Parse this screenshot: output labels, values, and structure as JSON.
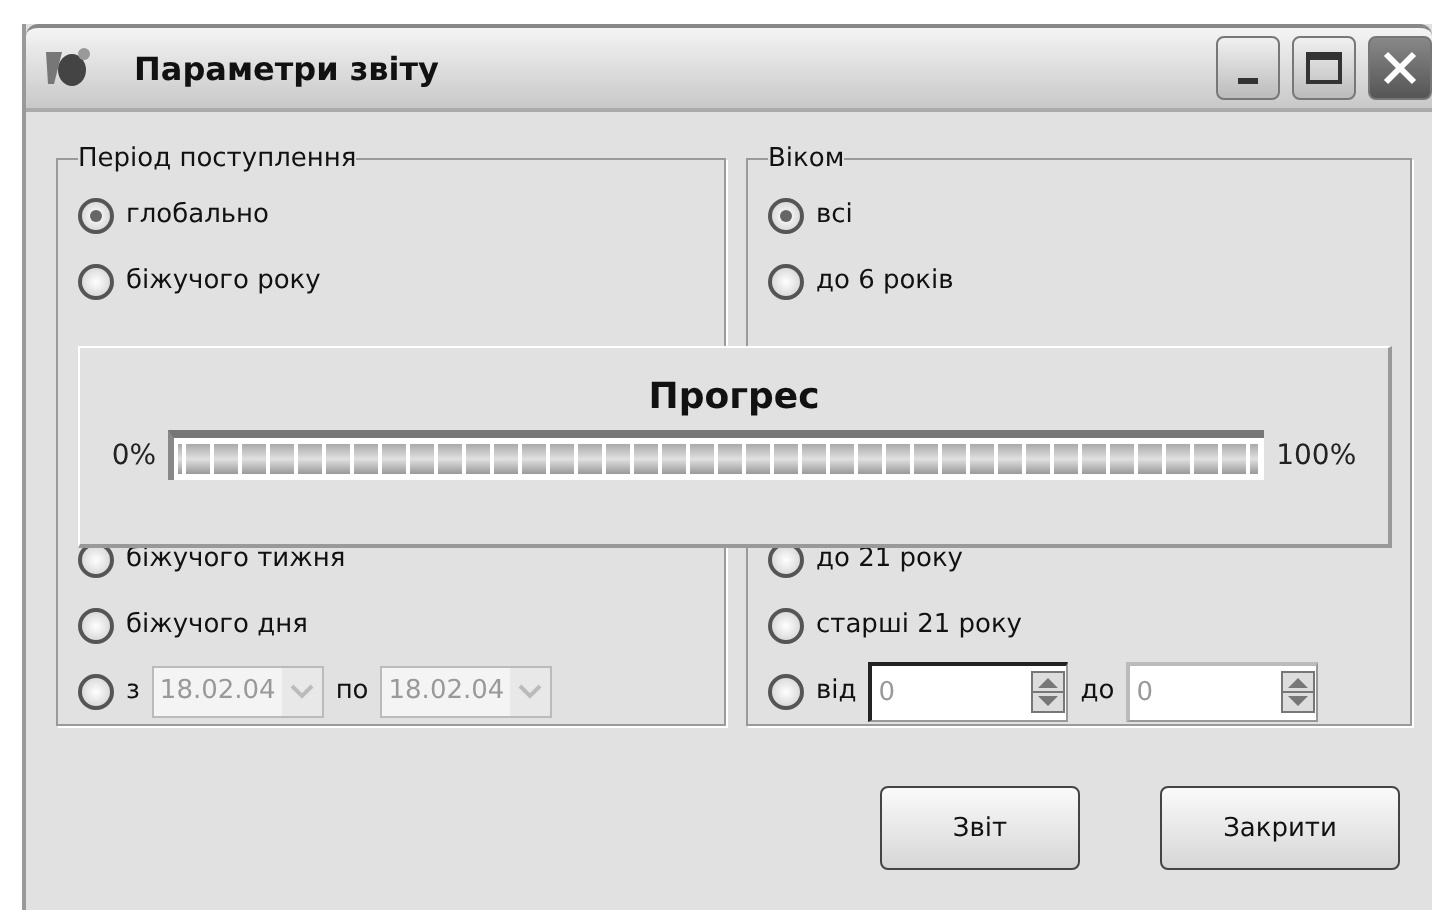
{
  "window": {
    "title": "Параметри звіту"
  },
  "groups": [
    {
      "legend": "Період поступлення",
      "options": [
        {
          "kind": "option",
          "label": "глобально",
          "selected": true
        },
        {
          "kind": "option",
          "label": "біжучого року",
          "selected": false
        },
        {
          "kind": "option",
          "label": "біжучого тижня",
          "selected": false
        },
        {
          "kind": "option",
          "label": "біжучого дня",
          "selected": false
        },
        {
          "kind": "date_range",
          "label": "з",
          "from": "18.02.04",
          "to_label": "по",
          "to": "18.02.04",
          "selected": false
        }
      ]
    },
    {
      "legend": "Віком",
      "options": [
        {
          "kind": "option",
          "label": "всі",
          "selected": true
        },
        {
          "kind": "option",
          "label": "до 6 років",
          "selected": false
        },
        {
          "kind": "option",
          "label": "до 21 року",
          "selected": false
        },
        {
          "kind": "option",
          "label": "старші 21 року",
          "selected": false
        },
        {
          "kind": "number_range",
          "label": "від",
          "from": "0",
          "to_label": "до",
          "to": "0",
          "selected": false
        }
      ]
    }
  ],
  "progress": {
    "title": "Прогрес",
    "min_label": "0%",
    "max_label": "100%",
    "level": 1
  },
  "buttons": [
    "Звіт",
    "Закрити"
  ]
}
